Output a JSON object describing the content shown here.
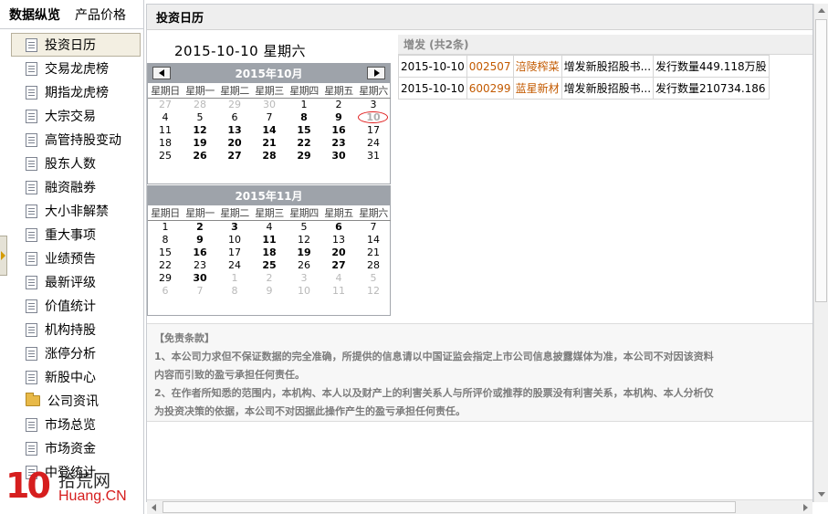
{
  "sidebar": {
    "tabs": [
      "数据纵览",
      "产品价格"
    ],
    "items": [
      {
        "label": "投资日历",
        "icon": "document-icon",
        "active": true
      },
      {
        "label": "交易龙虎榜",
        "icon": "document-icon"
      },
      {
        "label": "期指龙虎榜",
        "icon": "document-icon"
      },
      {
        "label": "大宗交易",
        "icon": "document-icon"
      },
      {
        "label": "高管持股变动",
        "icon": "document-icon"
      },
      {
        "label": "股东人数",
        "icon": "document-icon"
      },
      {
        "label": "融资融券",
        "icon": "document-icon"
      },
      {
        "label": "大小非解禁",
        "icon": "document-icon"
      },
      {
        "label": "重大事项",
        "icon": "document-icon"
      },
      {
        "label": "业绩预告",
        "icon": "document-icon"
      },
      {
        "label": "最新评级",
        "icon": "document-icon"
      },
      {
        "label": "价值统计",
        "icon": "document-icon"
      },
      {
        "label": "机构持股",
        "icon": "document-icon"
      },
      {
        "label": "涨停分析",
        "icon": "document-icon"
      },
      {
        "label": "新股中心",
        "icon": "document-icon"
      },
      {
        "label": "公司资讯",
        "icon": "folder-icon"
      },
      {
        "label": "市场总览",
        "icon": "document-icon"
      },
      {
        "label": "市场资金",
        "icon": "document-icon"
      },
      {
        "label": "中登统计",
        "icon": "document-icon"
      }
    ]
  },
  "watermark": {
    "num": "10",
    "cn": "拾荒网",
    "en": "Huang.CN"
  },
  "main": {
    "header": "投资日历",
    "current_date": "2015-10-10  星期六",
    "weekdays": [
      "星期日",
      "星期一",
      "星期二",
      "星期三",
      "星期四",
      "星期五",
      "星期六"
    ],
    "calendars": [
      {
        "title": "2015年10月",
        "rows": [
          [
            {
              "d": "27",
              "s": "dim"
            },
            {
              "d": "28",
              "s": "dim"
            },
            {
              "d": "29",
              "s": "dim"
            },
            {
              "d": "30",
              "s": "dim"
            },
            {
              "d": "1",
              "s": ""
            },
            {
              "d": "2",
              "s": ""
            },
            {
              "d": "3",
              "s": ""
            }
          ],
          [
            {
              "d": "4",
              "s": ""
            },
            {
              "d": "5",
              "s": ""
            },
            {
              "d": "6",
              "s": ""
            },
            {
              "d": "7",
              "s": ""
            },
            {
              "d": "8",
              "s": "bold"
            },
            {
              "d": "9",
              "s": "bold"
            },
            {
              "d": "10",
              "s": "sel"
            }
          ],
          [
            {
              "d": "11",
              "s": ""
            },
            {
              "d": "12",
              "s": "bold"
            },
            {
              "d": "13",
              "s": "bold"
            },
            {
              "d": "14",
              "s": "bold"
            },
            {
              "d": "15",
              "s": "bold"
            },
            {
              "d": "16",
              "s": "bold"
            },
            {
              "d": "17",
              "s": ""
            }
          ],
          [
            {
              "d": "18",
              "s": ""
            },
            {
              "d": "19",
              "s": "bold"
            },
            {
              "d": "20",
              "s": "bold"
            },
            {
              "d": "21",
              "s": "bold"
            },
            {
              "d": "22",
              "s": "bold"
            },
            {
              "d": "23",
              "s": "bold"
            },
            {
              "d": "24",
              "s": ""
            }
          ],
          [
            {
              "d": "25",
              "s": ""
            },
            {
              "d": "26",
              "s": "bold"
            },
            {
              "d": "27",
              "s": "bold"
            },
            {
              "d": "28",
              "s": "bold"
            },
            {
              "d": "29",
              "s": "bold"
            },
            {
              "d": "30",
              "s": "bold"
            },
            {
              "d": "31",
              "s": ""
            }
          ]
        ]
      },
      {
        "title": "2015年11月",
        "rows": [
          [
            {
              "d": "1",
              "s": ""
            },
            {
              "d": "2",
              "s": "bold"
            },
            {
              "d": "3",
              "s": "bold"
            },
            {
              "d": "4",
              "s": ""
            },
            {
              "d": "5",
              "s": ""
            },
            {
              "d": "6",
              "s": "bold"
            },
            {
              "d": "7",
              "s": ""
            }
          ],
          [
            {
              "d": "8",
              "s": ""
            },
            {
              "d": "9",
              "s": "bold"
            },
            {
              "d": "10",
              "s": ""
            },
            {
              "d": "11",
              "s": "bold"
            },
            {
              "d": "12",
              "s": ""
            },
            {
              "d": "13",
              "s": ""
            },
            {
              "d": "14",
              "s": ""
            }
          ],
          [
            {
              "d": "15",
              "s": ""
            },
            {
              "d": "16",
              "s": "bold"
            },
            {
              "d": "17",
              "s": ""
            },
            {
              "d": "18",
              "s": "bold"
            },
            {
              "d": "19",
              "s": "bold"
            },
            {
              "d": "20",
              "s": "bold"
            },
            {
              "d": "21",
              "s": ""
            }
          ],
          [
            {
              "d": "22",
              "s": ""
            },
            {
              "d": "23",
              "s": ""
            },
            {
              "d": "24",
              "s": ""
            },
            {
              "d": "25",
              "s": "bold"
            },
            {
              "d": "26",
              "s": ""
            },
            {
              "d": "27",
              "s": "bold"
            },
            {
              "d": "28",
              "s": ""
            }
          ],
          [
            {
              "d": "29",
              "s": ""
            },
            {
              "d": "30",
              "s": "bold"
            },
            {
              "d": "1",
              "s": "dim"
            },
            {
              "d": "2",
              "s": "dim"
            },
            {
              "d": "3",
              "s": "dim"
            },
            {
              "d": "4",
              "s": "dim"
            },
            {
              "d": "5",
              "s": "dim"
            }
          ],
          [
            {
              "d": "6",
              "s": "dim"
            },
            {
              "d": "7",
              "s": "dim"
            },
            {
              "d": "8",
              "s": "dim"
            },
            {
              "d": "9",
              "s": "dim"
            },
            {
              "d": "10",
              "s": "dim"
            },
            {
              "d": "11",
              "s": "dim"
            },
            {
              "d": "12",
              "s": "dim"
            }
          ]
        ]
      }
    ],
    "issue": {
      "title": "增发 (共2条)",
      "rows": [
        {
          "date": "2015-10-10",
          "code": "002507",
          "name": "涪陵榨菜",
          "desc": "增发新股招股书...",
          "detail": "发行数量449.118万股"
        },
        {
          "date": "2015-10-10",
          "code": "600299",
          "name": "蓝星新材",
          "desc": "增发新股招股书...",
          "detail": "发行数量210734.186"
        }
      ]
    },
    "disclaimer": {
      "title": "【免责条款】",
      "lines": [
        "1、本公司力求但不保证数据的完全准确，所提供的信息请以中国证监会指定上市公司信息披露媒体为准，本公司不对因该资料",
        "内容而引致的盈亏承担任何责任。",
        "2、在作者所知悉的范围内，本机构、本人以及财产上的利害关系人与所评价或推荐的股票没有利害关系，本机构、本人分析仅",
        "为投资决策的依据，本公司不对因据此操作产生的盈亏承担任何责任。"
      ]
    }
  }
}
